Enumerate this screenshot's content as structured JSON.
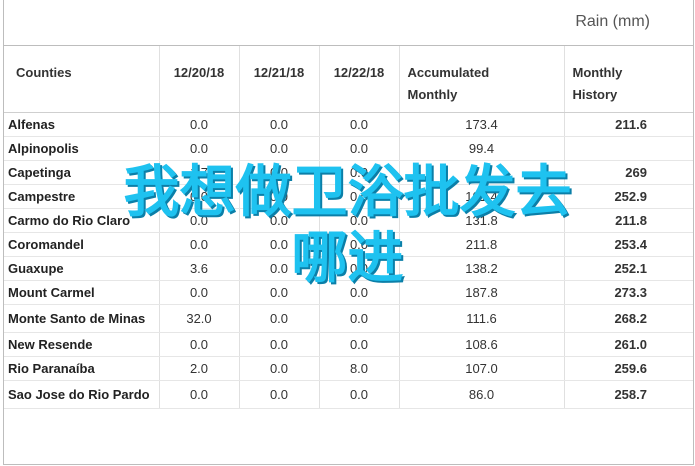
{
  "title": "Rain (mm)",
  "headers": {
    "counties": "Counties",
    "d1": "12/20/18",
    "d2": "12/21/18",
    "d3": "12/22/18",
    "accumulated_1": "Accumulated",
    "accumulated_2": "Monthly",
    "history_1": "Monthly",
    "history_2": "History"
  },
  "rows": [
    {
      "county": "Alfenas",
      "d1": "0.0",
      "d2": "0.0",
      "d3": "0.0",
      "acc": "173.4",
      "hist": "211.6"
    },
    {
      "county": "Alpinopolis",
      "d1": "0.0",
      "d2": "0.0",
      "d3": "0.0",
      "acc": "99.4",
      "hist": ""
    },
    {
      "county": "Capetinga",
      "d1": "1.7",
      "d2": "0.0",
      "d3": "0.0",
      "acc": "...",
      "hist": "269"
    },
    {
      "county": "Campestre",
      "d1": "0.0",
      "d2": "0.0",
      "d3": "0.0",
      "acc": "101.4",
      "hist": "252.9"
    },
    {
      "county": "Carmo do Rio Claro",
      "d1": "0.0",
      "d2": "0.0",
      "d3": "0.0",
      "acc": "131.8",
      "hist": "211.8"
    },
    {
      "county": "Coromandel",
      "d1": "0.0",
      "d2": "0.0",
      "d3": "0.0",
      "acc": "211.8",
      "hist": "253.4"
    },
    {
      "county": "Guaxupe",
      "d1": "3.6",
      "d2": "0.0",
      "d3": "0.0",
      "acc": "138.2",
      "hist": "252.1"
    },
    {
      "county": "Mount Carmel",
      "d1": "0.0",
      "d2": "0.0",
      "d3": "0.0",
      "acc": "187.8",
      "hist": "273.3"
    },
    {
      "county": "Monte Santo de Minas",
      "d1": "32.0",
      "d2": "0.0",
      "d3": "0.0",
      "acc": "111.6",
      "hist": "268.2"
    },
    {
      "county": "New Resende",
      "d1": "0.0",
      "d2": "0.0",
      "d3": "0.0",
      "acc": "108.6",
      "hist": "261.0"
    },
    {
      "county": "Rio Paranaíba",
      "d1": "2.0",
      "d2": "0.0",
      "d3": "8.0",
      "acc": "107.0",
      "hist": "259.6"
    },
    {
      "county": "Sao Jose do Rio Pardo",
      "d1": "0.0",
      "d2": "0.0",
      "d3": "0.0",
      "acc": "86.0",
      "hist": "258.7"
    }
  ],
  "overlay": {
    "line1": "我想做卫浴批发去",
    "line2": "哪进"
  }
}
